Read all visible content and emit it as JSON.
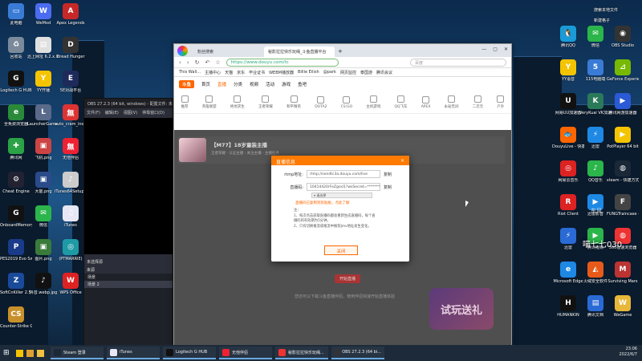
{
  "desktop": {
    "left_icons": [
      {
        "label": "此电脑",
        "color": "#3a7bd5",
        "glyph": "▭"
      },
      {
        "label": "WeMod",
        "color": "#4b6cf0",
        "glyph": "W"
      },
      {
        "label": "Apex Legends",
        "color": "#c62828",
        "glyph": "A"
      },
      {
        "label": "回收站",
        "color": "#7a8a9a",
        "glyph": "♻"
      },
      {
        "label": "迅上网址 6.2.x.lnk",
        "color": "#e0e0e0",
        "glyph": "▤"
      },
      {
        "label": "Dread Hunger",
        "color": "#333",
        "glyph": "D"
      },
      {
        "label": "Logitech G HUB",
        "color": "#111",
        "glyph": "G"
      },
      {
        "label": "YY开播",
        "color": "#f5c400",
        "glyph": "Y"
      },
      {
        "label": "5E对战平台",
        "color": "#1d2a5a",
        "glyph": "E"
      },
      {
        "label": "全免费浏览器",
        "color": "#2a8a3a",
        "glyph": "e"
      },
      {
        "label": "LauncherGame.exe - 快...",
        "color": "#5a6a8a",
        "glyph": "L"
      },
      {
        "label": "auto_cram_installer_3.4...",
        "color": "#d33",
        "glyph": "無"
      },
      {
        "label": "腾讯网",
        "color": "#2ba245",
        "glyph": "✚"
      },
      {
        "label": "飞机.png",
        "color": "#c44",
        "glyph": "▣"
      },
      {
        "label": "无他伴侣",
        "color": "#e23",
        "glyph": "無"
      },
      {
        "label": "Cheat Engine",
        "color": "#223",
        "glyph": "⚙"
      },
      {
        "label": "大能.png",
        "color": "#2a4a8a",
        "glyph": "▣"
      },
      {
        "label": "iTunes64Setup.exe",
        "color": "#ccc",
        "glyph": "♪"
      },
      {
        "label": "OnboardMemoryManager",
        "color": "#111",
        "glyph": "G"
      },
      {
        "label": "微信",
        "color": "#2bb54a",
        "glyph": "✉"
      },
      {
        "label": "iTunes",
        "color": "#e7e7f5",
        "glyph": "♫"
      },
      {
        "label": "PES2019 Evo Switcher.exe",
        "color": "#1a3a8a",
        "glyph": "P"
      },
      {
        "label": "图片.png",
        "color": "#3a7a3a",
        "glyph": "▣"
      },
      {
        "label": "(PTMARRIE)",
        "color": "#1e9aa5",
        "glyph": "◎"
      },
      {
        "label": "SoftCnKiller 2.54 (破...",
        "color": "#1a4a9a",
        "glyph": "Z"
      },
      {
        "label": "抖音.webp.jpg",
        "color": "#111",
        "glyph": "♪"
      },
      {
        "label": "WPS Office",
        "color": "#d22",
        "glyph": "W"
      },
      {
        "label": "Counter-Strike Global...",
        "color": "#c8902a",
        "glyph": "CS"
      }
    ],
    "right_icons": [
      {
        "label": "腾讯QQ",
        "color": "#1a9bd8",
        "glyph": "🐧"
      },
      {
        "label": "微信",
        "color": "#2bb54a",
        "glyph": "✉"
      },
      {
        "label": "OBS Studio",
        "color": "#333",
        "glyph": "◉"
      },
      {
        "label": "YY语音",
        "color": "#f5c400",
        "glyph": "Y"
      },
      {
        "label": "115电脑端",
        "color": "#3a7bd5",
        "glyph": "5"
      },
      {
        "label": "GeForce Experience",
        "color": "#76b900",
        "glyph": "⊿"
      },
      {
        "label": "网易UU加速器",
        "color": "#111",
        "glyph": "U"
      },
      {
        "label": "VeryKuai VK加速器",
        "color": "#2a7a5a",
        "glyph": "K"
      },
      {
        "label": "腾讯网游加速器",
        "color": "#2a5ad5",
        "glyph": "▶"
      },
      {
        "label": "DouyuLive - 快捷方式",
        "color": "#f60",
        "glyph": "🐟"
      },
      {
        "label": "迅雷",
        "color": "#1e88e5",
        "glyph": "⚡"
      },
      {
        "label": "PotPlayer 64 bit",
        "color": "#f5c400",
        "glyph": "▶"
      },
      {
        "label": "网易云音乐",
        "color": "#d22",
        "glyph": "◎"
      },
      {
        "label": "QQ音乐",
        "color": "#2bb54a",
        "glyph": "♪"
      },
      {
        "label": "steam - 快捷方式",
        "color": "#1b2838",
        "glyph": "◍"
      },
      {
        "label": "Riot Client",
        "color": "#d22",
        "glyph": "R"
      },
      {
        "label": "迅雷影音",
        "color": "#1e88e5",
        "glyph": "▶"
      },
      {
        "label": "FUNGTraincase - 快捷...",
        "color": "#444",
        "glyph": "F"
      },
      {
        "label": "迅雷",
        "color": "#2a6ad5",
        "glyph": "⚡"
      },
      {
        "label": "腾讯视频",
        "color": "#2bb54a",
        "glyph": "▶"
      },
      {
        "label": "360极速浏览器",
        "color": "#e33",
        "glyph": "◍"
      },
      {
        "label": "Microsoft Edge",
        "color": "#1e88e5",
        "glyph": "e"
      },
      {
        "label": "火绒安全软件",
        "color": "#e85a1a",
        "glyph": "◭"
      },
      {
        "label": "Surviving Mars",
        "color": "#b33",
        "glyph": "M"
      },
      {
        "label": "HUMANKIN",
        "color": "#111",
        "glyph": "H"
      },
      {
        "label": "腾讯文档",
        "color": "#2a6ad5",
        "glyph": "▤"
      },
      {
        "label": "WeGame",
        "color": "#e8b83a",
        "glyph": "W"
      }
    ],
    "top_right": [
      "搜索本地文件",
      "新建格子"
    ],
    "watermark": "喵七七030",
    "watermark_small": "东风"
  },
  "obs": {
    "title": "OBS 27.2.3 (64 bit, windows) - 配置文件: 未命名 - 场景: 未命名",
    "menu": [
      "文件(F)",
      "编辑(E)",
      "视图(V)",
      "停靠窗口(D)"
    ],
    "dock_title": "来源",
    "dock_filter": "未选择源",
    "scenes": [
      "场景",
      "场景 2"
    ]
  },
  "browser": {
    "tabs": [
      {
        "label": "粉丝搜索"
      },
      {
        "label": "秘影拉拉快乐玩绳_斗鱼直播平台"
      }
    ],
    "url": "https://www.douyu.com/tc",
    "search_placeholder": "百度",
    "bookmarks": [
      "This Wall...",
      "主播中心",
      "天猫",
      "京东",
      "毕业证书",
      "WEBM播放器",
      "Billie Eilish",
      "@park",
      "网页监控",
      "泰国游",
      "腾讯会议"
    ],
    "site_nav": [
      "首页",
      "直播",
      "分类",
      "视频",
      "活动",
      "游戏",
      "鱼吧"
    ],
    "site_logo": "斗鱼",
    "categories": [
      "推荐",
      "英雄联盟",
      "绝地求生",
      "王者荣耀",
      "和平精英",
      "DOTA2",
      "CS:GO",
      "主机游戏",
      "QQ飞车",
      "APEX",
      "永劫无间",
      "二次元",
      "户外"
    ],
    "streamer_title": "【M77】18岁童装主播",
    "streamer_sub": "王者荣耀 · 认证主播 · 关注主播 · 主播任务",
    "start_btn": "开始直播",
    "bottom_tip": "您还可以下载斗鱼直播伴侣，使用伴侣快速开始直播体验",
    "promo": "试玩送礼"
  },
  "dialog": {
    "title": "直播信息",
    "close": "×",
    "rtmp_label": "rtmp地址:",
    "rtmp_value": "rtmp://sendtc3a.douyu.com/live",
    "key_label": "直播码:",
    "key_value": "10414420rFeZgsxl1?wsSecret=*************",
    "copy": "复制",
    "select_value": "▾ 请选择",
    "warn": "直播码已复制到剪贴板，点此了解",
    "notes": [
      "注：",
      "1、每次点击获取直播码都会重新生成直播码，每个直",
      "播码的有效期为5分钟。",
      "2、只有切换推流或推流中推荐Jmv地址发生变化。"
    ],
    "ok": "关闭"
  },
  "taskbar": {
    "items": [
      {
        "label": "Steam 登录",
        "color": "#1b2838"
      },
      {
        "label": "iTunes",
        "color": "#e7e7f5"
      },
      {
        "label": "Logitech G HUB",
        "color": "#111"
      },
      {
        "label": "无他伴侣",
        "color": "#e23"
      },
      {
        "label": "秘影拉拉快乐玩绳...",
        "color": "#e33"
      },
      {
        "label": "OBS 27.2.3 (64 bi...",
        "color": "#333"
      }
    ],
    "time": "23:06",
    "date": "2022/6/7"
  }
}
